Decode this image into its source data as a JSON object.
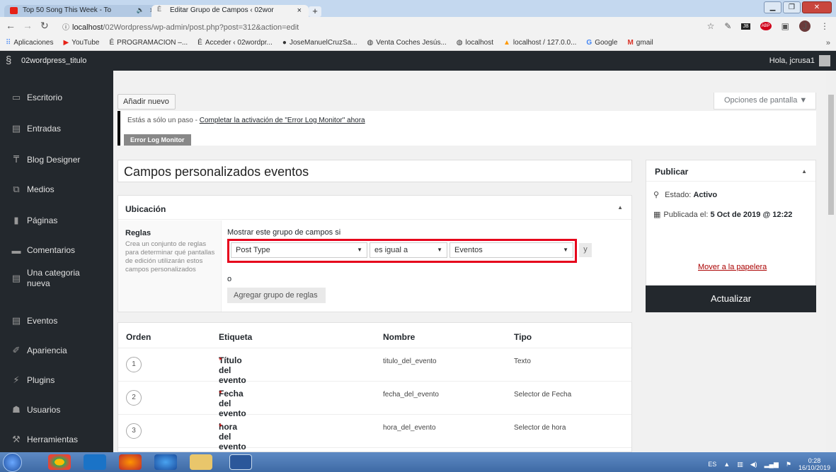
{
  "browser": {
    "tabs": [
      {
        "title": "Top 50 Song This Week - To",
        "close": "×"
      },
      {
        "title": "Editar Grupo de Campos ‹ 02wor",
        "close": "×"
      }
    ],
    "new_tab": "+",
    "url_host": "localhost",
    "url_path": "/02Wordpress/wp-admin/post.php?post=312&action=edit",
    "bookmarks": [
      {
        "icon": "apps-icon",
        "label": "Aplicaciones"
      },
      {
        "icon": "youtube-icon",
        "label": "YouTube"
      },
      {
        "icon": "wp-icon",
        "label": "PROGRAMACION –..."
      },
      {
        "icon": "wp-icon",
        "label": "Acceder ‹ 02wordpr..."
      },
      {
        "icon": "github-icon",
        "label": "JoseManuelCruzSa..."
      },
      {
        "icon": "globe-icon",
        "label": "Venta Coches Jesús..."
      },
      {
        "icon": "globe-icon",
        "label": "localhost"
      },
      {
        "icon": "phpmyadmin-icon",
        "label": "localhost / 127.0.0..."
      },
      {
        "icon": "google-icon",
        "label": "Google"
      },
      {
        "icon": "gmail-icon",
        "label": "gmail"
      }
    ],
    "bookmarks_more": "»",
    "avatar_letter": "J"
  },
  "adminbar": {
    "site_name": "02wordpress_titulo",
    "greeting": "Hola, jcrusa1"
  },
  "sidebar": {
    "items": [
      {
        "icon": "dashboard-icon",
        "label": "Escritorio"
      },
      {
        "icon": "posts-icon",
        "label": "Entradas"
      },
      {
        "icon": "pin-icon",
        "label": "Blog Designer"
      },
      {
        "icon": "media-icon",
        "label": "Medios"
      },
      {
        "icon": "pages-icon",
        "label": "Páginas"
      },
      {
        "icon": "comments-icon",
        "label": "Comentarios"
      },
      {
        "icon": "posts-icon",
        "label": "Una categoria nueva"
      },
      {
        "icon": "posts-icon",
        "label": "Eventos"
      },
      {
        "icon": "appearance-icon",
        "label": "Apariencia"
      },
      {
        "icon": "plugins-icon",
        "label": "Plugins"
      },
      {
        "icon": "users-icon",
        "label": "Usuarios"
      },
      {
        "icon": "tools-icon",
        "label": "Herramientas"
      }
    ]
  },
  "main": {
    "add_new": "Añadir nuevo",
    "screen_options": "Opciones de pantalla ▼",
    "notice": {
      "prefix": "Estás a sólo un paso - ",
      "link": "Completar la activación de \"Error Log Monitor\" ahora",
      "badge": "Error Log Monitor"
    },
    "group_title": "Campos personalizados eventos",
    "location": {
      "heading": "Ubicación",
      "rules_heading": "Reglas",
      "rules_desc": "Crea un conjunto de reglas para determinar qué pantallas de edición utilizarán estos campos personalizados",
      "show_if": "Mostrar este grupo de campos si",
      "param": "Post Type",
      "operator": "es igual a",
      "value": "Eventos",
      "and": "y",
      "or": "o",
      "add_group": "Agregar grupo de reglas"
    },
    "fields": {
      "headers": [
        "Orden",
        "Etiqueta",
        "Nombre",
        "Tipo"
      ],
      "rows": [
        {
          "order": "1",
          "label": "Título del evento",
          "name": "titulo_del_evento",
          "type": "Texto"
        },
        {
          "order": "2",
          "label": "Fecha del evento",
          "name": "fecha_del_evento",
          "type": "Selector de Fecha"
        },
        {
          "order": "3",
          "label": "hora del evento",
          "name": "hora_del_evento",
          "type": "Selector de hora"
        }
      ],
      "required_mark": "*"
    }
  },
  "publish": {
    "title": "Publicar",
    "status_label": "Estado:",
    "status_value": "Activo",
    "published_label": "Publicada el:",
    "published_value": "5 Oct de 2019 @ 12:22",
    "trash": "Mover a la papelera",
    "update": "Actualizar"
  },
  "taskbar": {
    "lang": "ES",
    "time": "0:28",
    "date": "16/10/2019"
  }
}
